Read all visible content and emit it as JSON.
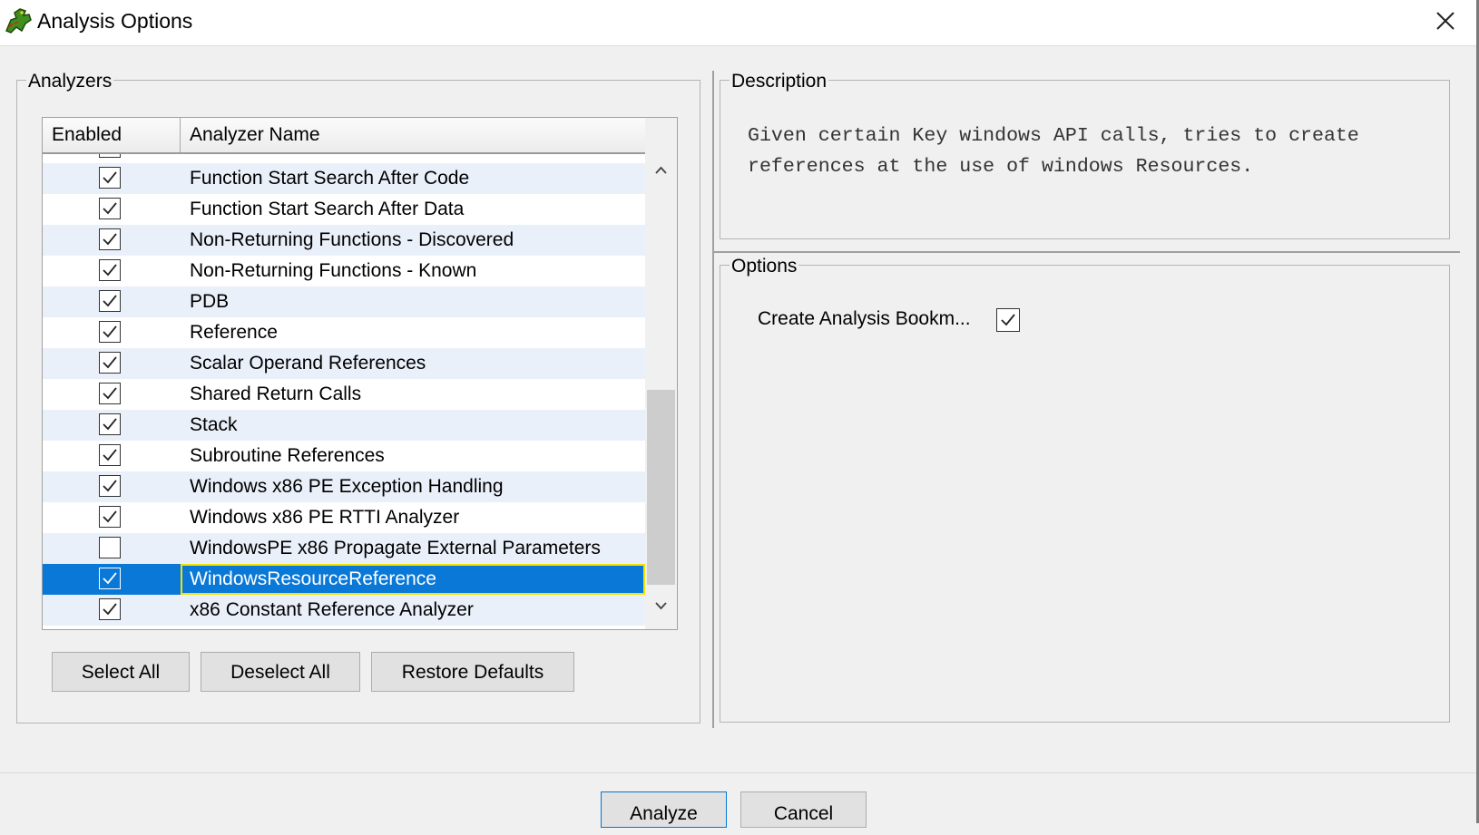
{
  "window": {
    "title": "Analysis Options",
    "icon": "dragon-icon",
    "close_icon": "close-icon"
  },
  "analyzers": {
    "group_title": "Analyzers",
    "columns": [
      "Enabled",
      "Analyzer Name"
    ],
    "rows": [
      {
        "enabled": true,
        "name": "Function Start Search After Code"
      },
      {
        "enabled": true,
        "name": "Function Start Search After Data"
      },
      {
        "enabled": true,
        "name": "Non-Returning Functions - Discovered"
      },
      {
        "enabled": true,
        "name": "Non-Returning Functions - Known"
      },
      {
        "enabled": true,
        "name": "PDB"
      },
      {
        "enabled": true,
        "name": "Reference"
      },
      {
        "enabled": true,
        "name": "Scalar Operand References"
      },
      {
        "enabled": true,
        "name": "Shared Return Calls"
      },
      {
        "enabled": true,
        "name": "Stack"
      },
      {
        "enabled": true,
        "name": "Subroutine References"
      },
      {
        "enabled": true,
        "name": "Windows x86 PE Exception Handling"
      },
      {
        "enabled": true,
        "name": "Windows x86 PE RTTI Analyzer"
      },
      {
        "enabled": false,
        "name": "WindowsPE x86 Propagate External Parameters"
      },
      {
        "enabled": true,
        "name": "WindowsResourceReference",
        "selected": true
      },
      {
        "enabled": true,
        "name": "x86 Constant Reference Analyzer"
      }
    ],
    "buttons": {
      "select_all": "Select All",
      "deselect_all": "Deselect All",
      "restore_defaults": "Restore Defaults"
    }
  },
  "description": {
    "group_title": "Description",
    "text": "Given certain Key windows API calls, tries to create\nreferences at the use of windows Resources."
  },
  "options": {
    "group_title": "Options",
    "items": [
      {
        "label": "Create Analysis Bookm...",
        "checked": true
      }
    ]
  },
  "footer": {
    "analyze": "Analyze",
    "cancel": "Cancel"
  },
  "colors": {
    "selection": "#0a78d7",
    "selection_border": "#f4e300",
    "alt_row": "#eaf0fa"
  }
}
